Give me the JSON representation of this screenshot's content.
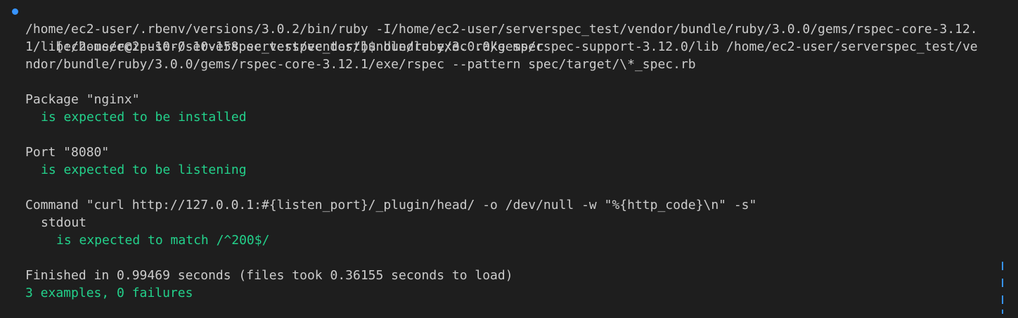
{
  "terminal": {
    "prompt_line": "[ec2-user@ip-10-0-10-158 serverspec_test]$ bundle exec rake spec",
    "command_lines": [
      "/home/ec2-user/.rbenv/versions/3.0.2/bin/ruby -I/home/ec2-user/serverspec_test/vendor/bundle/ruby/3.0.0/gems/rspec-core-3.12.",
      "1/lib:/home/ec2-user/serverspec_test/vendor/bundle/ruby/3.0.0/gems/rspec-support-3.12.0/lib /home/ec2-user/serverspec_test/ve",
      "ndor/bundle/ruby/3.0.0/gems/rspec-core-3.12.1/exe/rspec --pattern spec/target/\\*_spec.rb"
    ],
    "package_heading": "Package \"nginx\"",
    "package_result": "is expected to be installed",
    "port_heading": "Port \"8080\"",
    "port_result": "is expected to be listening",
    "command_heading": "Command \"curl http://127.0.0.1:#{listen_port}/_plugin/head/ -o /dev/null -w \"%{http_code}\\n\" -s\"",
    "stdout_label": "stdout",
    "stdout_result": "is expected to match /^200$/",
    "finished_line": "Finished in 0.99469 seconds (files took 0.36155 seconds to load)",
    "summary_line": "3 examples, 0 failures"
  },
  "colors": {
    "background": "#1e1e1e",
    "text": "#cccccc",
    "success": "#23d18b",
    "prompt_indicator": "#3794ff"
  }
}
